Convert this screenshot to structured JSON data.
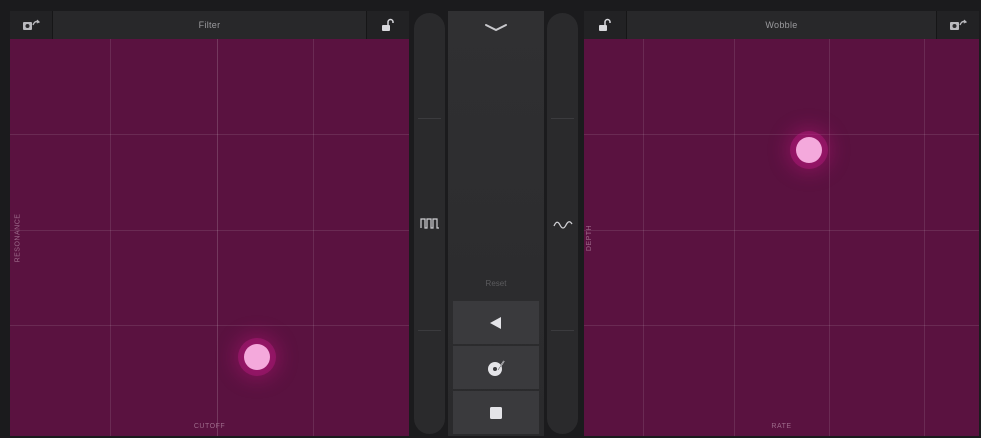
{
  "left_pad": {
    "title": "Filter",
    "x_axis_label": "CUTOFF",
    "y_axis_label": "RESONANCE",
    "left_icon": "record-transfer-icon",
    "right_icon": "unlocked-padlock-icon",
    "puck": {
      "x_value": 0.62,
      "y_value": 0.2
    }
  },
  "right_pad": {
    "title": "Wobble",
    "x_axis_label": "RATE",
    "y_axis_label": "DEPTH",
    "left_icon": "unlocked-padlock-icon",
    "right_icon": "record-transfer-icon",
    "puck": {
      "x_value": 0.57,
      "y_value": 0.72
    }
  },
  "left_rail": {
    "icon": "pulse-wave-icon"
  },
  "right_rail": {
    "icon": "sine-wave-icon"
  },
  "center": {
    "collapse_icon": "chevron-down-icon",
    "reset_label": "Reset",
    "buttons": [
      {
        "name": "reverse",
        "icon": "play-reverse-icon"
      },
      {
        "name": "scratch",
        "icon": "turntable-scratch-icon"
      },
      {
        "name": "stop",
        "icon": "stop-square-icon"
      }
    ]
  },
  "colors": {
    "pad_background": "#5a1240",
    "puck_fill": "#f4a9dc",
    "puck_glow": "#c81e8c",
    "chrome": "#28282a"
  }
}
